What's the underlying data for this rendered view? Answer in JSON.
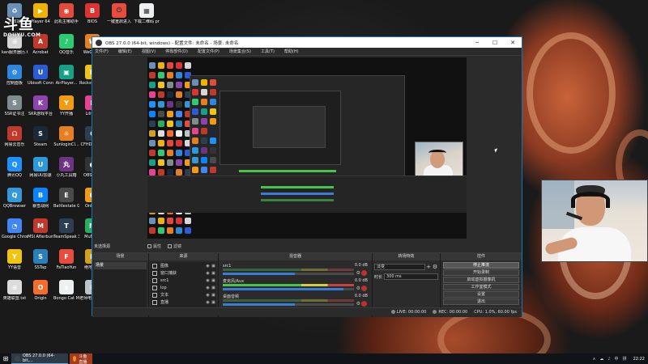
{
  "watermark": {
    "big": "斗鱼",
    "small": "DOUYU.COM"
  },
  "desktop_icons": [
    {
      "label": "回收站",
      "color": "#6a8fb8",
      "glyph": "♻"
    },
    {
      "label": "Player 64",
      "color": "#f0b400",
      "glyph": "▶"
    },
    {
      "label": "此机主哪助手",
      "color": "#e24a3a",
      "glyph": "◉"
    },
    {
      "label": "BIOS",
      "color": "#d33",
      "glyph": "B"
    },
    {
      "label": "kan服务器历.txt",
      "color": "#d7d7d7",
      "glyph": "≡"
    },
    {
      "label": "Acrobat",
      "color": "#c0392b",
      "glyph": "A"
    },
    {
      "label": "QQ音乐",
      "color": "#2ecc71",
      "glyph": "♪"
    },
    {
      "label": "WeGame",
      "color": "#e67e22",
      "glyph": "W"
    },
    {
      "label": "控制面板",
      "color": "#2e86de",
      "glyph": "⚙"
    },
    {
      "label": "Ubisoft Connect",
      "color": "#2b5cd6",
      "glyph": "U"
    },
    {
      "label": "AirPlayer...",
      "color": "#16a085",
      "glyph": "▣"
    },
    {
      "label": "Rockst Game",
      "color": "#f1c40f",
      "glyph": "R"
    },
    {
      "label": "SSR证书注",
      "color": "#7f8c8d",
      "glyph": "S"
    },
    {
      "label": "SKR游戏平台",
      "color": "#8e44ad",
      "glyph": "K"
    },
    {
      "label": "YY开播",
      "color": "#f39c12",
      "glyph": "Y"
    },
    {
      "label": "Lili代理",
      "color": "#e84393",
      "glyph": "L"
    },
    {
      "label": "网易云音乐",
      "color": "#c0392b",
      "glyph": "☊"
    },
    {
      "label": "Steam",
      "color": "#1b2838",
      "glyph": "S"
    },
    {
      "label": "SunloginCl...",
      "color": "#e67e22",
      "glyph": "☼"
    },
    {
      "label": "CFHDS Star",
      "color": "#2c3e50",
      "glyph": "C"
    },
    {
      "label": "腾讯QQ",
      "color": "#1e90ff",
      "glyph": "Q"
    },
    {
      "label": "网易UU加速",
      "color": "#2d98da",
      "glyph": "U"
    },
    {
      "label": "小丸工具箱",
      "color": "#6c3483",
      "glyph": "丸"
    },
    {
      "label": "OBS St...",
      "color": "#333",
      "glyph": "●"
    },
    {
      "label": "QQBrowser",
      "color": "#3498db",
      "glyph": "Q"
    },
    {
      "label": "暴雪战网",
      "color": "#0a84ff",
      "glyph": "B"
    },
    {
      "label": "Battlestate Games L...",
      "color": "#4a4a4a",
      "glyph": "E"
    },
    {
      "label": "Onbo...",
      "color": "#f39c12",
      "glyph": "O"
    },
    {
      "label": "Google Chrome",
      "color": "#4285f4",
      "glyph": "◔"
    },
    {
      "label": "MSI Afterburner",
      "color": "#c0392b",
      "glyph": "M"
    },
    {
      "label": "TeamSpeak 3",
      "color": "#2c3e50",
      "glyph": "T"
    },
    {
      "label": "MuMu...",
      "color": "#27ae60",
      "glyph": "M"
    },
    {
      "label": "YY语音",
      "color": "#f1c40f",
      "glyph": "Y"
    },
    {
      "label": "SSTap",
      "color": "#2980b9",
      "glyph": "S"
    },
    {
      "label": "FaTiaoYun",
      "color": "#e74c3c",
      "glyph": "F"
    },
    {
      "label": "绝地求生",
      "color": "#d4a017",
      "glyph": "P"
    },
    {
      "label": "英雄联盟.txt",
      "color": "#dcdcdc",
      "glyph": "≡"
    },
    {
      "label": "Origin",
      "color": "#f56c2d",
      "glyph": "O"
    },
    {
      "label": "Bongo Cat Mver.exe",
      "color": "#ecf0f1",
      "glyph": "ᴥ"
    },
    {
      "label": "老师电脑配置清单",
      "color": "#bdc3c7",
      "glyph": "≡"
    }
  ],
  "top_icons": [
    {
      "label": "一键重启进入",
      "color": "#e74c3c",
      "glyph": "⏻"
    },
    {
      "label": "下载二维码 png",
      "color": "#ecf0f1",
      "glyph": "▦"
    }
  ],
  "obs": {
    "title": "OBS 27.0.0 (64-bit, windows) - 配置文件: 未命名 - 场景: 未命名",
    "menu": [
      "文件(F)",
      "编辑(E)",
      "视图(V)",
      "停靠部件(D)",
      "配置文件(P)",
      "场景集合(S)",
      "工具(T)",
      "帮助(H)"
    ],
    "controls": {
      "minimize": "─",
      "maximize": "☐",
      "close": "✕"
    },
    "selected_source_label": "未选择源",
    "scene_tabs": [
      "属性",
      "滤镜"
    ],
    "docks": {
      "scenes": {
        "header": "场景",
        "items": [
          "场景"
        ]
      },
      "sources": {
        "header": "来源",
        "items": [
          "图像",
          "窗口捕获",
          "src1",
          "lop",
          "文本",
          "直播"
        ]
      },
      "mixer": {
        "header": "混音器",
        "channels": [
          {
            "name": "src1",
            "db": "0.0 dB",
            "level": 0.55,
            "active": false
          },
          {
            "name": "麦克风/Aux",
            "db": "0.0 dB",
            "level": 0.92,
            "active": true
          },
          {
            "name": "桌面音频",
            "db": "0.0 dB",
            "level": 0.55,
            "active": false
          }
        ]
      },
      "transitions": {
        "header": "转场特效",
        "type_value": "淡变",
        "duration_label": "时长",
        "duration_value": "300 ms"
      },
      "controls": {
        "header": "控件",
        "buttons": [
          "停止推流",
          "开始录制",
          "启动虚拟摄像机",
          "工作室模式",
          "设置",
          "退出"
        ]
      }
    },
    "status": {
      "live": "LIVE: 00:00:00",
      "rec": "REC: 00:00:00",
      "cpu": "CPU: 1.0%, 60.00 fps"
    }
  },
  "taskbar": {
    "start_glyph": "⊞",
    "apps": [
      {
        "label": "OBS 27.0.0 (64-bit,...",
        "kind": "obs"
      },
      {
        "label": "斗鱼直播",
        "kind": "fire"
      }
    ],
    "tray": [
      "∧",
      "☁",
      "♪",
      "中",
      "拼"
    ],
    "clock": "22:22"
  },
  "colors": {
    "accent": "#3b7bd9",
    "mute_red": "#c03030",
    "meter_green": "#47c447"
  }
}
